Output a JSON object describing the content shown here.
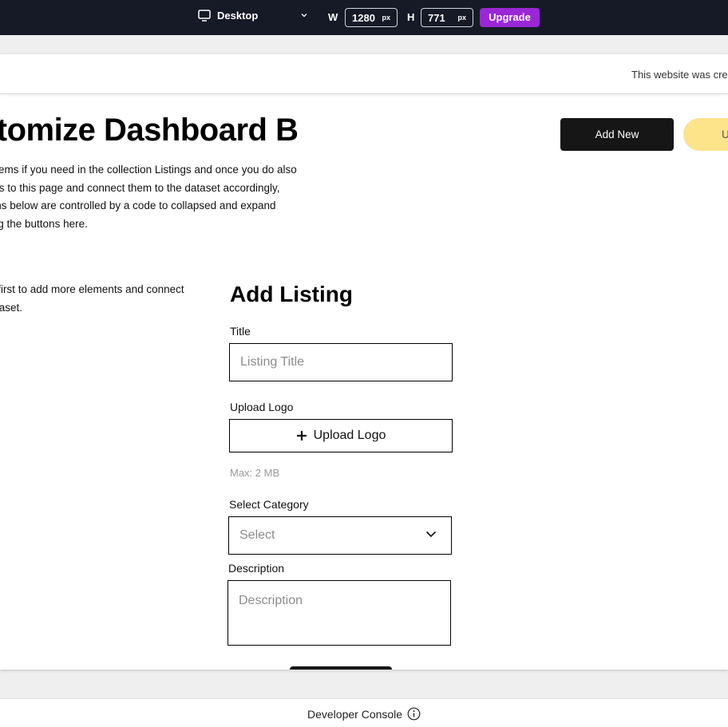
{
  "topbar": {
    "device_label": "Desktop",
    "icons": {
      "device": "monitor-icon",
      "chevron": "chevron-down-icon"
    },
    "width_label": "W",
    "width_value": "1280",
    "height_label": "H",
    "height_value": "771",
    "unit": "px",
    "upgrade_label": "Upgrade",
    "upgrade_color": "#9a27d5"
  },
  "banner": {
    "text": "This website was cre"
  },
  "page": {
    "heading": "stomize Dashboard B",
    "intro_lines": [
      "e items if you need in the collection Listings and once you do also",
      "ents to this page and connect them to the dataset accordingly,",
      "tions below are controlled by a code to collapsed and expand",
      "king the buttons here."
    ],
    "side_note_lines": [
      "ck first to add more elements and connect",
      "dataset."
    ],
    "add_new_label": "Add New",
    "yellow_button_label": "U",
    "yellow_color": "#fde38a"
  },
  "form": {
    "title": "Add Listing",
    "title_label": "Title",
    "title_placeholder": "Listing Title",
    "logo_label": "Upload Logo",
    "upload_button_label": "Upload Logo",
    "upload_icon": "plus-icon",
    "max_hint": "Max: 2 MB",
    "category_label": "Select Category",
    "category_placeholder": "Select",
    "description_label": "Description",
    "description_placeholder": "Description"
  },
  "console": {
    "label": "Developer Console",
    "icon": "info-icon"
  }
}
